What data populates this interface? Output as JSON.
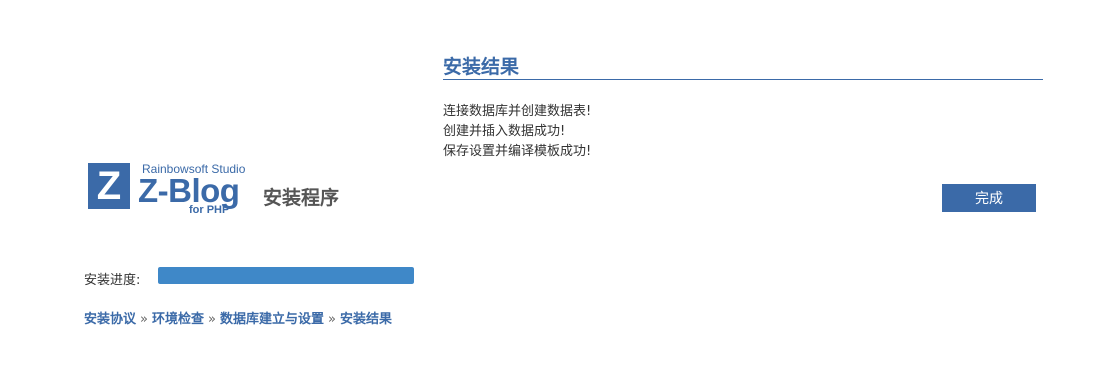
{
  "logo": {
    "letter": "Z",
    "studio": "Rainbowsoft Studio",
    "brand": "Z-Blog",
    "for_php": "for PHP",
    "installer_title": "安装程序"
  },
  "progress": {
    "label": "安装进度:",
    "percent": 100
  },
  "steps": [
    "安装协议",
    "环境检查",
    "数据库建立与设置",
    "安装结果"
  ],
  "steps_separator": "»",
  "result": {
    "title": "安装结果",
    "messages": [
      "连接数据库并创建数据表!",
      "创建并插入数据成功!",
      "保存设置并编译模板成功!"
    ],
    "finish_label": "完成"
  },
  "colors": {
    "accent": "#3b6aa8",
    "progress_fill": "#3f88c8"
  }
}
